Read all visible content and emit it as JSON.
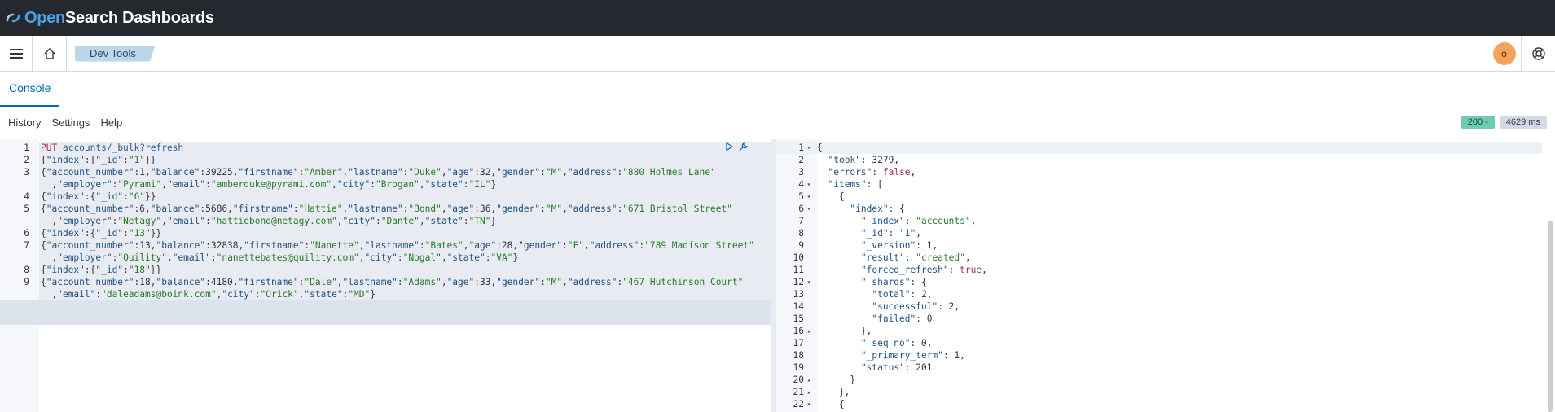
{
  "app": {
    "brand_open": "Open",
    "brand_rest": "Search Dashboards"
  },
  "nav": {
    "breadcrumb": "Dev Tools",
    "avatar_initial": "o"
  },
  "tabs": [
    {
      "label": "Console"
    }
  ],
  "toolbar": {
    "history": "History",
    "settings": "Settings",
    "help": "Help"
  },
  "status": {
    "code": "200 -",
    "time": "4629 ms"
  },
  "request_lines": [
    {
      "n": "1",
      "text": "PUT accounts/_bulk?refresh"
    },
    {
      "n": "2",
      "text": "{\"index\":{\"_id\":\"1\"}}"
    },
    {
      "n": "3",
      "text": "{\"account_number\":1,\"balance\":39225,\"firstname\":\"Amber\",\"lastname\":\"Duke\",\"age\":32,\"gender\":\"M\",\"address\":\"880 Holmes Lane\""
    },
    {
      "n": "",
      "text": "  ,\"employer\":\"Pyrami\",\"email\":\"amberduke@pyrami.com\",\"city\":\"Brogan\",\"state\":\"IL\"}"
    },
    {
      "n": "4",
      "text": "{\"index\":{\"_id\":\"6\"}}"
    },
    {
      "n": "5",
      "text": "{\"account_number\":6,\"balance\":5686,\"firstname\":\"Hattie\",\"lastname\":\"Bond\",\"age\":36,\"gender\":\"M\",\"address\":\"671 Bristol Street\""
    },
    {
      "n": "",
      "text": "  ,\"employer\":\"Netagy\",\"email\":\"hattiebond@netagy.com\",\"city\":\"Dante\",\"state\":\"TN\"}"
    },
    {
      "n": "6",
      "text": "{\"index\":{\"_id\":\"13\"}}"
    },
    {
      "n": "7",
      "text": "{\"account_number\":13,\"balance\":32838,\"firstname\":\"Nanette\",\"lastname\":\"Bates\",\"age\":28,\"gender\":\"F\",\"address\":\"789 Madison Street\""
    },
    {
      "n": "",
      "text": "  ,\"employer\":\"Quility\",\"email\":\"nanettebates@quility.com\",\"city\":\"Nogal\",\"state\":\"VA\"}"
    },
    {
      "n": "8",
      "text": "{\"index\":{\"_id\":\"18\"}}"
    },
    {
      "n": "9",
      "text": "{\"account_number\":18,\"balance\":4180,\"firstname\":\"Dale\",\"lastname\":\"Adams\",\"age\":33,\"gender\":\"M\",\"address\":\"467 Hutchinson Court\""
    },
    {
      "n": "",
      "text": "  ,\"email\":\"daleadams@boink.com\",\"city\":\"Orick\",\"state\":\"MD\"}"
    }
  ],
  "response_lines": [
    {
      "n": "1",
      "fold": "▾",
      "text": "{"
    },
    {
      "n": "2",
      "fold": "",
      "text": "  \"took\": 3279,"
    },
    {
      "n": "3",
      "fold": "",
      "text": "  \"errors\": false,"
    },
    {
      "n": "4",
      "fold": "▾",
      "text": "  \"items\": ["
    },
    {
      "n": "5",
      "fold": "▾",
      "text": "    {"
    },
    {
      "n": "6",
      "fold": "▾",
      "text": "      \"index\": {"
    },
    {
      "n": "7",
      "fold": "",
      "text": "        \"_index\": \"accounts\","
    },
    {
      "n": "8",
      "fold": "",
      "text": "        \"_id\": \"1\","
    },
    {
      "n": "9",
      "fold": "",
      "text": "        \"_version\": 1,"
    },
    {
      "n": "10",
      "fold": "",
      "text": "        \"result\": \"created\","
    },
    {
      "n": "11",
      "fold": "",
      "text": "        \"forced_refresh\": true,"
    },
    {
      "n": "12",
      "fold": "▾",
      "text": "        \"_shards\": {"
    },
    {
      "n": "13",
      "fold": "",
      "text": "          \"total\": 2,"
    },
    {
      "n": "14",
      "fold": "",
      "text": "          \"successful\": 2,"
    },
    {
      "n": "15",
      "fold": "",
      "text": "          \"failed\": 0"
    },
    {
      "n": "16",
      "fold": "▴",
      "text": "        },"
    },
    {
      "n": "17",
      "fold": "",
      "text": "        \"_seq_no\": 0,"
    },
    {
      "n": "18",
      "fold": "",
      "text": "        \"_primary_term\": 1,"
    },
    {
      "n": "19",
      "fold": "",
      "text": "        \"status\": 201"
    },
    {
      "n": "20",
      "fold": "▴",
      "text": "      }"
    },
    {
      "n": "21",
      "fold": "▴",
      "text": "    },"
    },
    {
      "n": "22",
      "fold": "▾",
      "text": "    {"
    }
  ]
}
